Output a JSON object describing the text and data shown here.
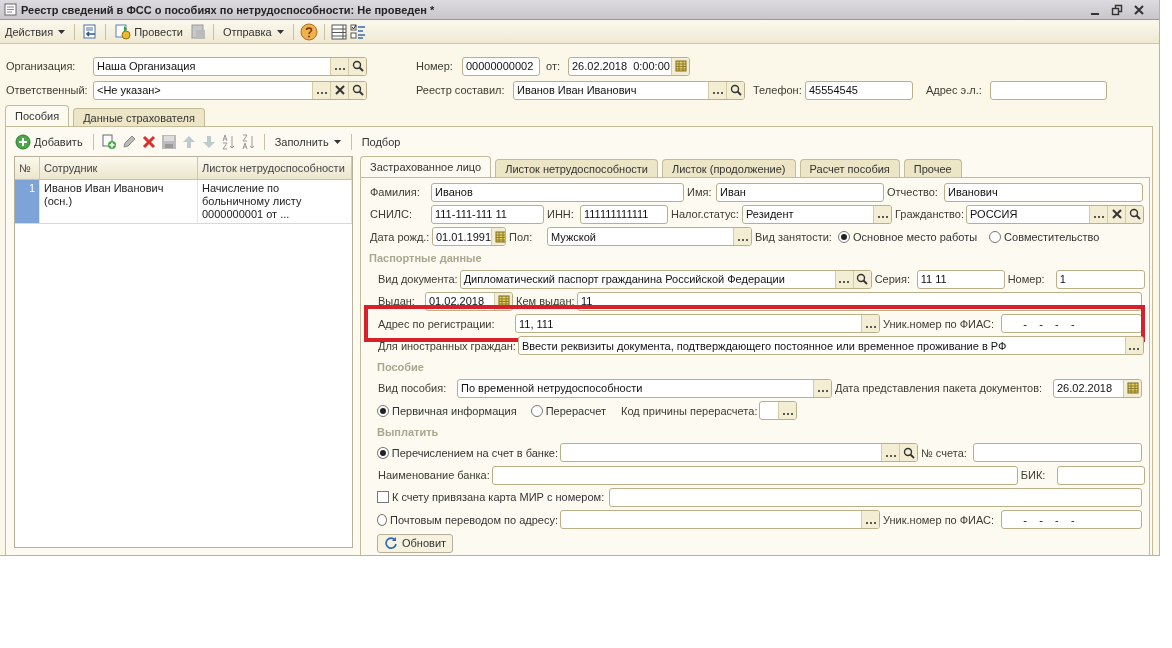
{
  "window": {
    "title": "Реестр сведений в ФСС о пособиях по нетрудоспособности: Не проведен *"
  },
  "toolbar": [
    {
      "kind": "menu",
      "label": "Действия"
    },
    {
      "kind": "button",
      "label": "Провести"
    },
    {
      "kind": "menu",
      "label": "Отправка"
    }
  ],
  "header": {
    "rows": [
      {
        "items": [
          {
            "kind": "label",
            "text": "Организация:"
          },
          {
            "kind": "field",
            "value": "Наша Организация",
            "choice_button": true,
            "search_button": true
          },
          {
            "kind": "label",
            "text": "Номер:"
          },
          {
            "kind": "field",
            "value": "00000000002"
          },
          {
            "kind": "label",
            "text": "от:"
          },
          {
            "kind": "field",
            "value": "26.02.2018  0:00:00",
            "calendar_button": true
          }
        ]
      },
      {
        "items": [
          {
            "kind": "label",
            "text": "Ответственный:"
          },
          {
            "kind": "field",
            "value": "<Не указан>",
            "choice_button": true,
            "clear_button": true,
            "search_button": true
          },
          {
            "kind": "label",
            "text": "Реестр составил:"
          },
          {
            "kind": "field",
            "value": "Иванов Иван Иванович",
            "choice_button": true,
            "search_button": true
          },
          {
            "kind": "label",
            "text": "Телефон:"
          },
          {
            "kind": "field",
            "value": "45554545"
          },
          {
            "kind": "label",
            "text": "Адрес э.л.:"
          },
          {
            "kind": "field"
          }
        ]
      }
    ]
  },
  "tabs": [
    {
      "label": "Пособия",
      "selected": true
    },
    {
      "label": "Данные страхователя",
      "selected": false
    }
  ],
  "list_toolbar": [
    {
      "kind": "button",
      "label": "Добавить"
    },
    {
      "kind": "menu",
      "label": "Заполнить"
    },
    {
      "kind": "button",
      "label": "Подбор"
    }
  ],
  "table": {
    "columns": [
      "№",
      "Сотрудник",
      "Листок нетрудоспособности"
    ],
    "rows": [
      {
        "selected": true,
        "cells": [
          "1",
          "Иванов Иван Иванович (осн.)",
          "Начисление по больничному листу 0000000001 от ..."
        ]
      }
    ]
  },
  "detail_tabs": [
    {
      "label": "Застрахованное лицо",
      "selected": true
    },
    {
      "label": "Листок нетрудоспособности",
      "selected": false
    },
    {
      "label": "Листок (продолжение)",
      "selected": false
    },
    {
      "label": "Расчет пособия",
      "selected": false
    },
    {
      "label": "Прочее",
      "selected": false
    }
  ],
  "form": {
    "rows": [
      {
        "kind": "fields",
        "highlighted": false,
        "items": [
          {
            "kind": "label",
            "text": "Фамилия:"
          },
          {
            "kind": "field",
            "value": "Иванов"
          },
          {
            "kind": "label",
            "text": "Имя:"
          },
          {
            "kind": "field",
            "value": "Иван"
          },
          {
            "kind": "label",
            "text": "Отчество:"
          },
          {
            "kind": "field",
            "value": "Иванович"
          }
        ]
      },
      {
        "kind": "fields",
        "highlighted": false,
        "items": [
          {
            "kind": "label",
            "text": "СНИЛС:"
          },
          {
            "kind": "field",
            "value": "111-111-111 11"
          },
          {
            "kind": "label",
            "text": "ИНН:"
          },
          {
            "kind": "field",
            "value": "111111111111"
          },
          {
            "kind": "label",
            "text": "Налог.статус:"
          },
          {
            "kind": "field",
            "value": "Резидент",
            "choice_button": true
          },
          {
            "kind": "label",
            "text": "Гражданство:"
          },
          {
            "kind": "field",
            "value": "РОССИЯ",
            "choice_button": true,
            "clear_button": true,
            "search_button": true
          }
        ]
      },
      {
        "kind": "fields",
        "highlighted": false,
        "items": [
          {
            "kind": "label",
            "text": "Дата рожд.:"
          },
          {
            "kind": "field",
            "value": "01.01.1991",
            "calendar_button": true
          },
          {
            "kind": "label",
            "text": "Пол:"
          },
          {
            "kind": "field",
            "value": "Мужской",
            "choice_button": true
          },
          {
            "kind": "label",
            "text": "Вид занятости:"
          },
          {
            "kind": "radio",
            "text": "Основное место работы",
            "selected": true
          },
          {
            "kind": "radio",
            "text": "Совместительство",
            "selected": false
          }
        ]
      },
      {
        "kind": "section",
        "title": "Паспортные данные"
      },
      {
        "kind": "fields",
        "highlighted": false,
        "items": [
          {
            "kind": "label",
            "text": "Вид документа:"
          },
          {
            "kind": "field",
            "value": "Дипломатический паспорт гражданина Российской Федерации",
            "choice_button": true,
            "search_button": true
          },
          {
            "kind": "label",
            "text": "Серия:"
          },
          {
            "kind": "field",
            "value": "11 11"
          },
          {
            "kind": "label",
            "text": "Номер:"
          },
          {
            "kind": "field",
            "value": "1"
          }
        ]
      },
      {
        "kind": "fields",
        "highlighted": false,
        "items": [
          {
            "kind": "label",
            "text": "Выдан:"
          },
          {
            "kind": "field",
            "value": "01.02.2018",
            "calendar_button": true
          },
          {
            "kind": "label",
            "text": "Кем выдан:"
          },
          {
            "kind": "field",
            "value": "11"
          }
        ]
      },
      {
        "kind": "fields",
        "highlighted": true,
        "items": [
          {
            "kind": "label",
            "text": "Адрес по регистрации:"
          },
          {
            "kind": "field",
            "value": "11, 111",
            "choice_button": true
          },
          {
            "kind": "label",
            "text": "Уник.номер по ФИАС:"
          },
          {
            "kind": "field",
            "value": "      -    -    -    -"
          }
        ]
      },
      {
        "kind": "fields",
        "highlighted": false,
        "items": [
          {
            "kind": "label",
            "text": "Для иностранных граждан:"
          },
          {
            "kind": "field",
            "value": "Ввести реквизиты документа, подтверждающего постоянное или временное проживание в РФ",
            "choice_button": true
          }
        ]
      },
      {
        "kind": "section",
        "title": "Пособие"
      },
      {
        "kind": "fields",
        "highlighted": false,
        "items": [
          {
            "kind": "label",
            "text": "Вид пособия:"
          },
          {
            "kind": "field",
            "value": "По временной нетрудоспособности",
            "choice_button": true
          },
          {
            "kind": "label",
            "text": "Дата представления пакета документов:"
          },
          {
            "kind": "field",
            "value": "26.02.2018",
            "calendar_button": true
          }
        ]
      },
      {
        "kind": "fields",
        "highlighted": false,
        "items": [
          {
            "kind": "radio",
            "text": "Первичная информация",
            "selected": true
          },
          {
            "kind": "radio",
            "text": "Перерасчет",
            "selected": false
          },
          {
            "kind": "label",
            "text": "Код причины перерасчета:"
          },
          {
            "kind": "field",
            "choice_button": true
          }
        ]
      },
      {
        "kind": "section",
        "title": "Выплатить"
      },
      {
        "kind": "fields",
        "highlighted": false,
        "items": [
          {
            "kind": "radio",
            "text": "Перечислением на счет в банке:",
            "selected": true
          },
          {
            "kind": "field",
            "choice_button": true,
            "search_button": true
          },
          {
            "kind": "label",
            "text": "№ счета:"
          },
          {
            "kind": "field"
          }
        ]
      },
      {
        "kind": "fields",
        "highlighted": false,
        "items": [
          {
            "kind": "label",
            "text": "Наименование банка:"
          },
          {
            "kind": "field"
          },
          {
            "kind": "label",
            "text": "БИК:"
          },
          {
            "kind": "field"
          }
        ]
      },
      {
        "kind": "fields",
        "highlighted": false,
        "items": [
          {
            "kind": "checkbox",
            "text": "К счету привязана карта МИР с номером:",
            "checked": false
          },
          {
            "kind": "field"
          }
        ]
      },
      {
        "kind": "fields",
        "highlighted": false,
        "items": [
          {
            "kind": "radio",
            "text": "Почтовым переводом по адресу:",
            "selected": false
          },
          {
            "kind": "field",
            "choice_button": true
          },
          {
            "kind": "label",
            "text": "Уник.номер по ФИАС:"
          },
          {
            "kind": "field",
            "value": "      -    -    -    -"
          }
        ]
      },
      {
        "kind": "button",
        "label": "Обновит"
      }
    ]
  }
}
